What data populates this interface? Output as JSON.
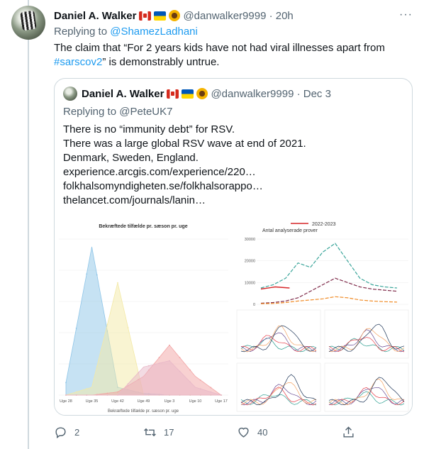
{
  "tweet": {
    "author_name": "Daniel A. Walker",
    "handle_time": "@danwalker9999 · 20h",
    "replying_prefix": "Replying to ",
    "replying_to": "@ShamezLadhani",
    "text_part1": "The claim that “For 2 years kids have not had viral illnesses apart from",
    "hashtag": "#sarscov2",
    "text_part2": "” is demonstrably untrue."
  },
  "quote": {
    "author_name": "Daniel A. Walker",
    "handle_time": "@danwalker9999 · Dec 3",
    "replying": "Replying to @PeteUK7",
    "lines": [
      "There is no “immunity debt” for RSV.",
      "There was a large global RSV wave at end of 2021.",
      "Denmark, Sweden, England.",
      "experience.arcgis.com/experience/220…",
      "folkhalsomyndigheten.se/folkhalsorappo…",
      "thelancet.com/journals/lanin…"
    ]
  },
  "left_chart": {
    "title": "Bekræftede tilfælde pr. sæson pr. uge",
    "xlabel": "Bekræftede tilfælde pr. sæson pr. uge",
    "x_ticks": [
      "Uge 28",
      "Uge 35",
      "Uge 42",
      "Uge 49",
      "Uge 3",
      "Uge 10",
      "Uge 17"
    ]
  },
  "right_chart": {
    "legend": "2022-2023",
    "title": "Antal analyserade prover",
    "y_ticks": [
      "30000",
      "20000",
      "10000",
      "0"
    ]
  },
  "chart_data": [
    {
      "type": "area",
      "title": "Bekræftede tilfælde pr. sæson pr. uge",
      "xlabel": "Bekræftede tilfælde pr. sæson pr. uge",
      "categories": [
        "Uge 28",
        "Uge 35",
        "Uge 42",
        "Uge 49",
        "Uge 3",
        "Uge 10",
        "Uge 17"
      ],
      "series": [
        {
          "color": "#8ec5e8",
          "values": [
            0.08,
            0.95,
            0.05,
            0.01,
            0.0,
            0.0,
            0.0
          ]
        },
        {
          "color": "#f3e9a6",
          "values": [
            0.0,
            0.05,
            0.72,
            0.0,
            0.0,
            0.0,
            0.0
          ]
        },
        {
          "color": "#f2a3a3",
          "values": [
            0.0,
            0.0,
            0.02,
            0.12,
            0.32,
            0.12,
            0.0
          ]
        },
        {
          "color": "#e8b8c8",
          "values": [
            0.0,
            0.0,
            0.0,
            0.18,
            0.22,
            0.05,
            0.0
          ]
        }
      ]
    },
    {
      "type": "line",
      "title": "Antal analyserade prover",
      "ylim": [
        0,
        30000
      ],
      "series": [
        {
          "name": "2022-2023",
          "color": "#d62728",
          "values": [
            7000,
            8000,
            7500
          ]
        },
        {
          "color": "#3aa59a",
          "values": [
            7500,
            9000,
            12000,
            19000,
            17000,
            24000,
            28000,
            20000,
            12000,
            9000,
            8000,
            7500
          ]
        },
        {
          "color": "#7f2b4a",
          "values": [
            500,
            800,
            1500,
            3000,
            6000,
            9000,
            12000,
            10000,
            8000,
            7000,
            6500,
            6000
          ]
        },
        {
          "color": "#f08a24",
          "values": [
            300,
            400,
            800,
            1500,
            2000,
            2500,
            3500,
            3000,
            2000,
            1500,
            1200,
            1000
          ]
        }
      ]
    }
  ],
  "actions": {
    "reply_count": "2",
    "retweet_count": "17",
    "like_count": "40"
  }
}
